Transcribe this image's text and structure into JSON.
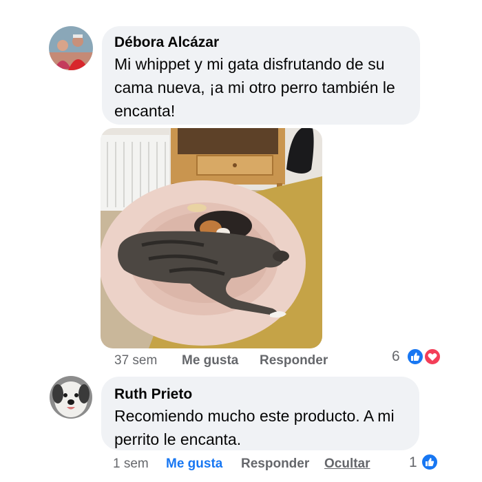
{
  "comments": [
    {
      "author": "Débora Alcázar",
      "text": "Mi whippet y mi gata disfrutando de su\ncama nueva, ¡a mi otro perro también le\nencanta!",
      "time": "37 sem",
      "like_label": "Me gusta",
      "reply_label": "Responder",
      "reaction_count": "6",
      "reactions": [
        "like-icon",
        "love-icon"
      ],
      "liked": false
    },
    {
      "author": "Ruth Prieto",
      "text": "Recomiendo mucho este producto. A mi\nperrito le encanta.",
      "time": "1 sem",
      "like_label": "Me gusta",
      "reply_label": "Responder",
      "hide_label": "Ocultar",
      "reaction_count": "1",
      "reactions": [
        "like-icon"
      ],
      "liked": true
    }
  ],
  "colors": {
    "bubble": "#f0f2f5",
    "secondary_text": "#65676b",
    "like_blue": "#1877f2",
    "love_red": "#f33e58"
  }
}
